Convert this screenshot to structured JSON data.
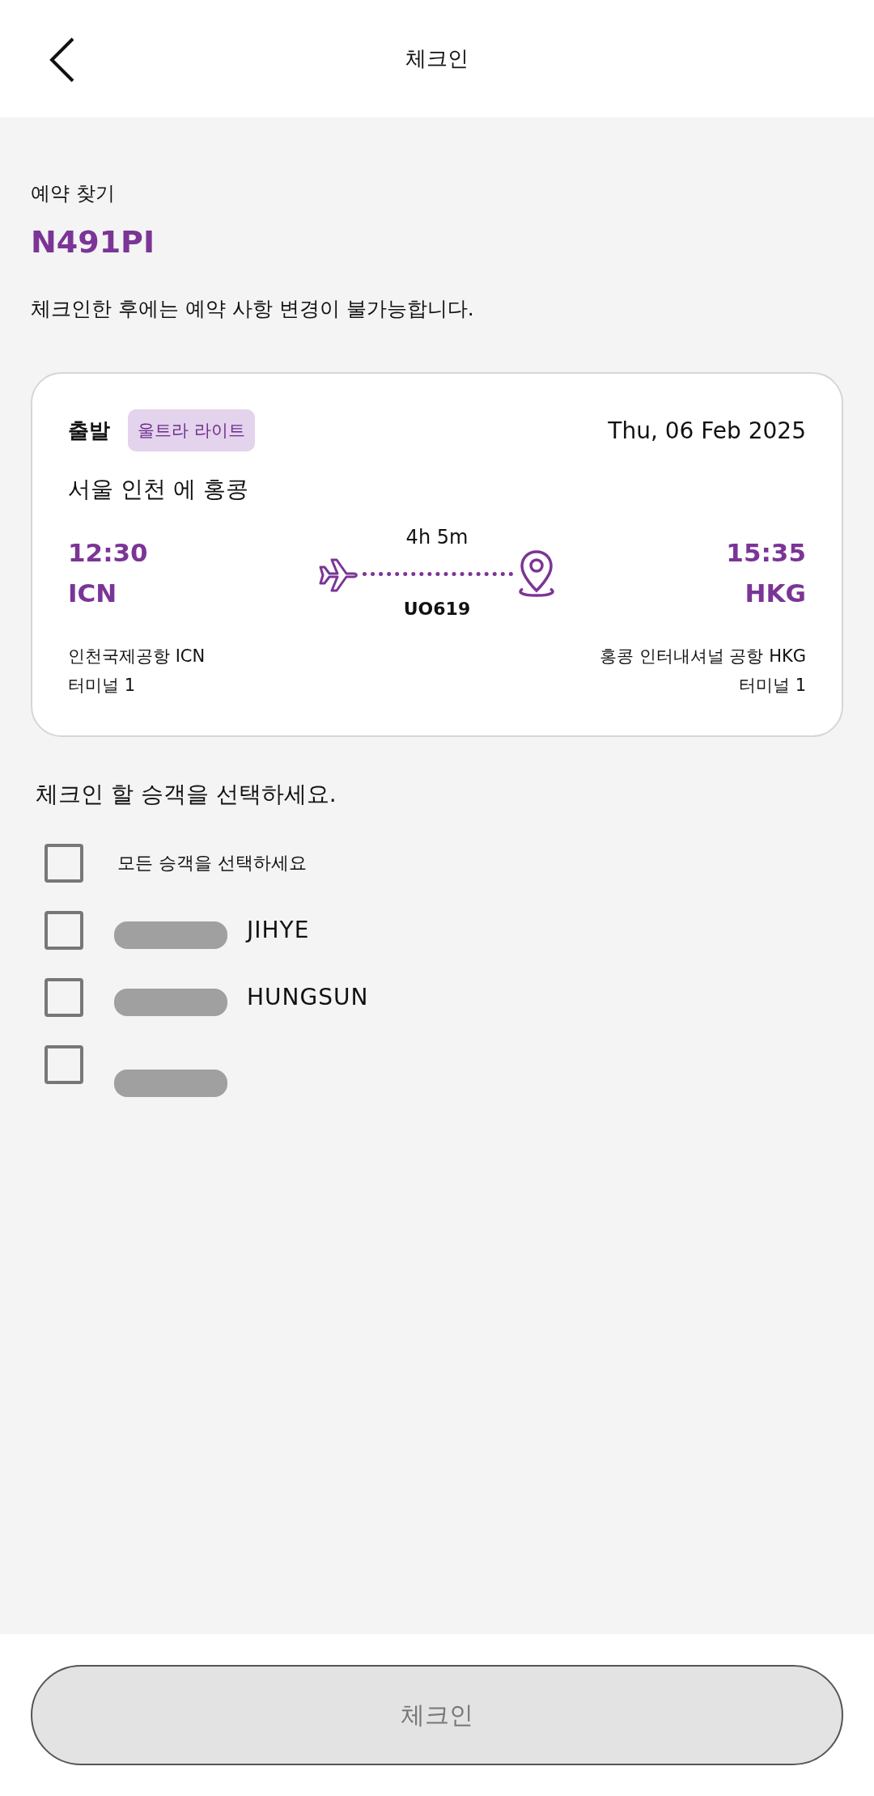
{
  "header": {
    "back_icon": true,
    "title": "체크인"
  },
  "booking": {
    "label": "예약 찾기",
    "code": "N491PI",
    "notice": "체크인한 후에는 예약 사항 변경이 불가능합니다."
  },
  "flight": {
    "direction": "출발",
    "fare_badge": "울트라 라이트",
    "date": "Thu, 06 Feb 2025",
    "route": "서울 인천 에 홍콩",
    "duration": "4h 5m",
    "flight_number": "UO619",
    "departure": {
      "time": "12:30",
      "code": "ICN",
      "airport": "인천국제공항 ICN",
      "terminal": "터미널 1"
    },
    "arrival": {
      "time": "15:35",
      "code": "HKG",
      "airport": "홍콩 인터내셔널 공항 HKG",
      "terminal": "터미널 1"
    }
  },
  "passengers": {
    "title": "체크인 할 승객을 선택하세요.",
    "items": [
      {
        "label": "모든 승객을 선택하세요",
        "checked": false,
        "redacted": false
      },
      {
        "label": "JIHYE",
        "checked": false,
        "redacted": true
      },
      {
        "label": "HUNGSUN",
        "checked": false,
        "redacted": true
      },
      {
        "checked": false,
        "redacted": true
      }
    ]
  },
  "checkin_button": {
    "label": "체크인",
    "disabled": true
  }
}
